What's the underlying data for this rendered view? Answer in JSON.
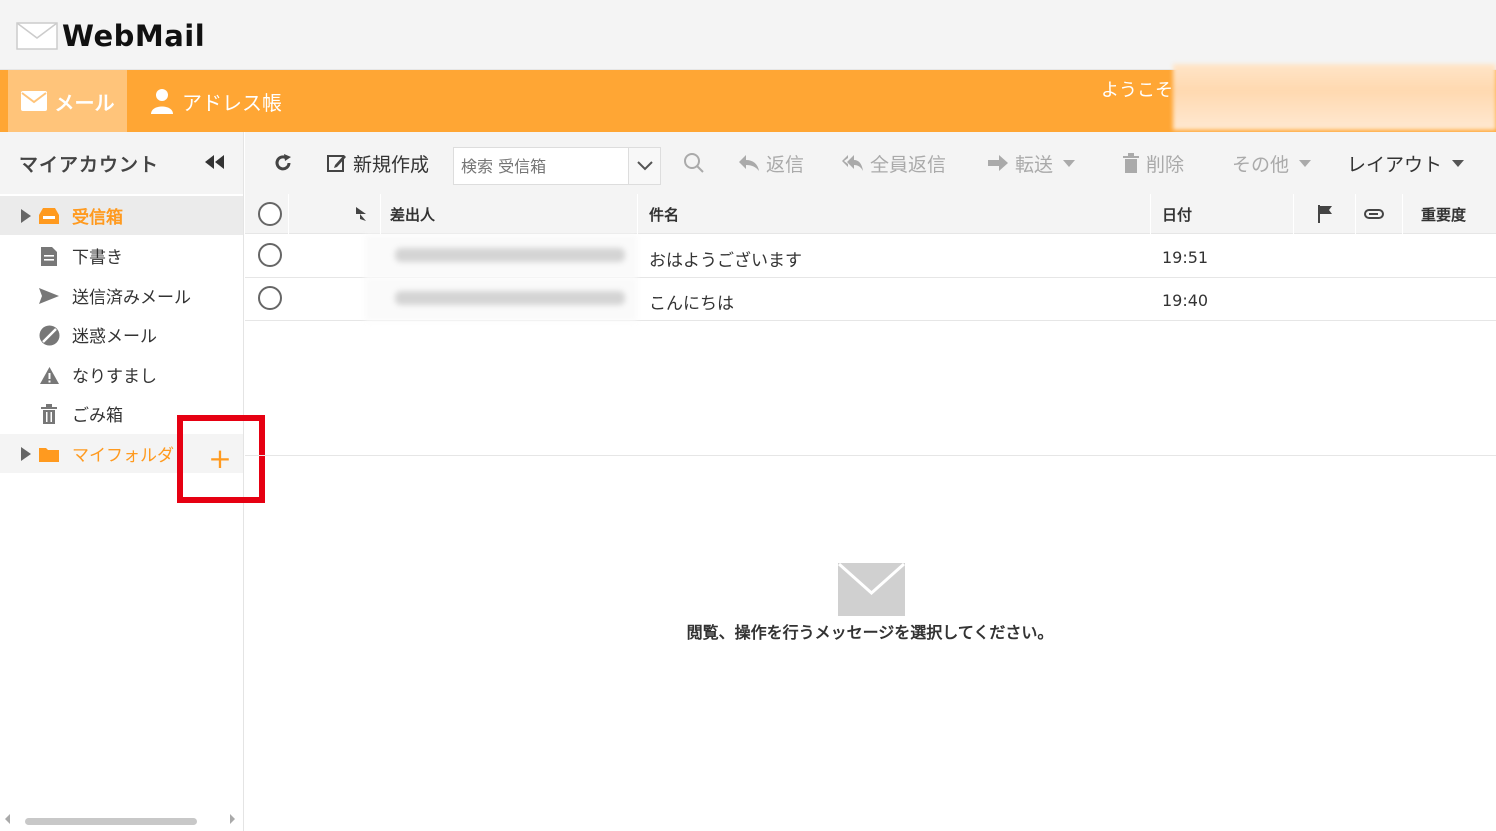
{
  "app": {
    "logo_text": "WebMail"
  },
  "nav": {
    "mail_label": "メール",
    "address_label": "アドレス帳",
    "welcome": "ようこそ"
  },
  "sidebar": {
    "title": "マイアカウント",
    "folders": [
      {
        "label": "受信箱",
        "icon": "inbox-icon",
        "selected": true
      },
      {
        "label": "下書き",
        "icon": "document-icon"
      },
      {
        "label": "送信済みメール",
        "icon": "send-icon"
      },
      {
        "label": "迷惑メール",
        "icon": "block-icon"
      },
      {
        "label": "なりすまし",
        "icon": "warning-icon"
      },
      {
        "label": "ごみ箱",
        "icon": "trash-icon"
      },
      {
        "label": "マイフォルダ",
        "icon": "folder-icon"
      }
    ],
    "add_label": "+"
  },
  "toolbar": {
    "new_label": "新規作成",
    "search_placeholder": "検索 受信箱",
    "reply_label": "返信",
    "reply_all_label": "全員返信",
    "forward_label": "転送",
    "delete_label": "削除",
    "more_label": "その他",
    "layout_label": "レイアウト"
  },
  "list": {
    "headers": {
      "from": "差出人",
      "subject": "件名",
      "date": "日付",
      "priority": "重要度"
    },
    "rows": [
      {
        "subject": "おはようございます",
        "date": "19:51"
      },
      {
        "subject": "こんにちは",
        "date": "19:40"
      }
    ]
  },
  "preview": {
    "message": "閲覧、操作を行うメッセージを選択してください。"
  },
  "colors": {
    "accent": "#ffa634",
    "accent_light": "#ffc47a",
    "folder_selected": "#ff9a1f",
    "highlight": "#e60012"
  }
}
